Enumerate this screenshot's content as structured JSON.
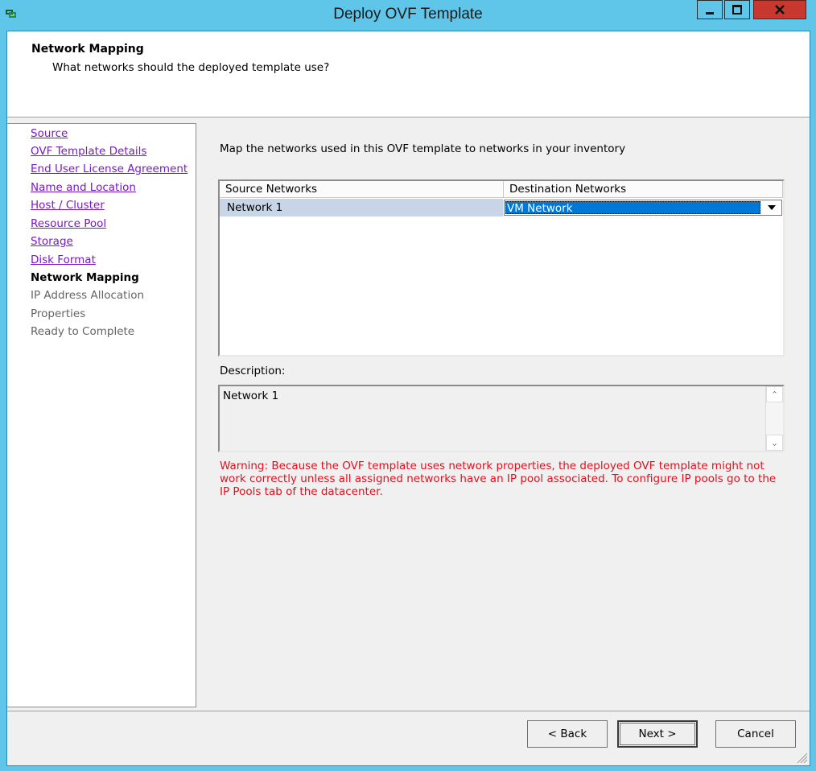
{
  "window": {
    "title": "Deploy OVF Template",
    "icon": "vsphere-app-icon"
  },
  "header": {
    "title": "Network Mapping",
    "subtitle": "What networks should the deployed template use?"
  },
  "nav": {
    "items": [
      {
        "label": "Source",
        "state": "completed-link"
      },
      {
        "label": "OVF Template Details",
        "state": "completed-link"
      },
      {
        "label": "End User License Agreement",
        "state": "completed-link"
      },
      {
        "label": "Name and Location",
        "state": "completed-link"
      },
      {
        "label": "Host / Cluster",
        "state": "completed-link"
      },
      {
        "label": "Resource Pool",
        "state": "completed-link"
      },
      {
        "label": "Storage",
        "state": "completed-link"
      },
      {
        "label": "Disk Format",
        "state": "completed-link"
      },
      {
        "label": "Network Mapping",
        "state": "current"
      },
      {
        "label": "IP Address Allocation",
        "state": "future"
      },
      {
        "label": "Properties",
        "state": "future"
      },
      {
        "label": "Ready to Complete",
        "state": "future"
      }
    ]
  },
  "main": {
    "intro": "Map the networks used in this OVF template to networks in your inventory",
    "table": {
      "columns": [
        "Source Networks",
        "Destination Networks"
      ],
      "rows": [
        {
          "source": "Network 1",
          "destination": "VM Network"
        }
      ]
    },
    "description_label": "Description:",
    "description_text": "Network 1",
    "warning": "Warning: Because the OVF template uses network properties, the deployed OVF template might not work correctly unless all assigned networks have an IP pool associated. To configure IP pools go to the IP Pools tab of the datacenter."
  },
  "footer": {
    "back_label": "< Back",
    "next_label": "Next >",
    "cancel_label": "Cancel"
  },
  "colors": {
    "title_bar": "#5fc6ea",
    "link": "#7a18c8",
    "warning": "#e2101e",
    "selection": "#0078d7",
    "row_highlight": "#c7d5e6",
    "close_button": "#c8382f"
  }
}
